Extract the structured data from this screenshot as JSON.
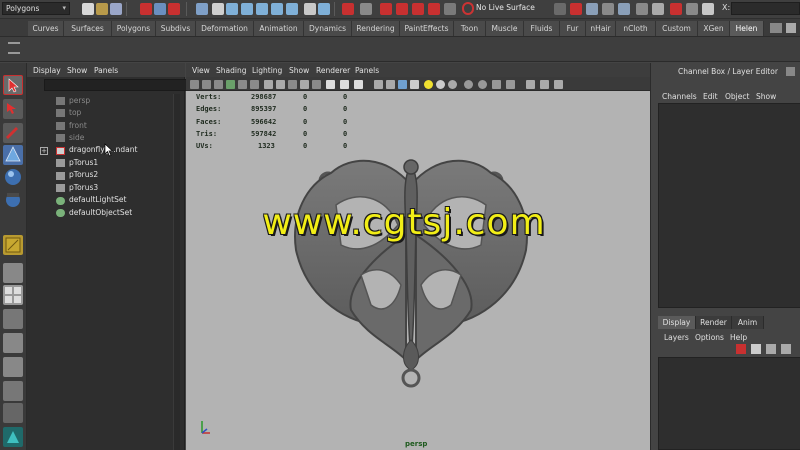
{
  "status_line": {
    "mode": "Polygons",
    "live_surface": "No Live Surface",
    "field_label": "X:"
  },
  "shelf": {
    "tabs": [
      "Curves",
      "Surfaces",
      "Polygons",
      "Subdivs",
      "Deformation",
      "Animation",
      "Dynamics",
      "Rendering",
      "PaintEffects",
      "Toon",
      "Muscle",
      "Fluids",
      "Fur",
      "nHair",
      "nCloth",
      "Custom",
      "XGen",
      "Helen"
    ],
    "active_tab": "Helen"
  },
  "outliner": {
    "menu": [
      "Display",
      "Show",
      "Panels"
    ],
    "items": [
      {
        "label": "persp",
        "dim": true,
        "icon": "camera-icon"
      },
      {
        "label": "top",
        "dim": true,
        "icon": "camera-icon"
      },
      {
        "label": "front",
        "dim": true,
        "icon": "camera-icon"
      },
      {
        "label": "side",
        "dim": true,
        "icon": "camera-icon"
      },
      {
        "label": "dragonfly_pendant",
        "dim": false,
        "icon": "mesh-icon",
        "expandable": true,
        "display_label": "dragonfly_...ndant"
      },
      {
        "label": "pTorus1",
        "dim": false,
        "icon": "transform-icon"
      },
      {
        "label": "pTorus2",
        "dim": false,
        "icon": "transform-icon"
      },
      {
        "label": "pTorus3",
        "dim": false,
        "icon": "transform-icon"
      },
      {
        "label": "defaultLightSet",
        "dim": false,
        "icon": "set-icon"
      },
      {
        "label": "defaultObjectSet",
        "dim": false,
        "icon": "set-icon"
      }
    ]
  },
  "viewport": {
    "menu": [
      "View",
      "Shading",
      "Lighting",
      "Show",
      "Renderer",
      "Panels"
    ],
    "hud": [
      {
        "label": "Verts:",
        "value": "298687",
        "c2": "0",
        "c3": "0"
      },
      {
        "label": "Edges:",
        "value": "895397",
        "c2": "0",
        "c3": "0"
      },
      {
        "label": "Faces:",
        "value": "596642",
        "c2": "0",
        "c3": "0"
      },
      {
        "label": "Tris:",
        "value": "597842",
        "c2": "0",
        "c3": "0"
      },
      {
        "label": "UVs:",
        "value": "1323",
        "c2": "0",
        "c3": "0"
      }
    ],
    "camera": "persp",
    "watermark": "www.cgtsj.com"
  },
  "channel_box": {
    "title": "Channel Box / Layer Editor",
    "menu": [
      "Channels",
      "Edit",
      "Object",
      "Show"
    ],
    "layer_tabs": [
      "Display",
      "Render",
      "Anim"
    ],
    "active_layer_tab": "Display",
    "layer_menu": [
      "Layers",
      "Options",
      "Help"
    ]
  },
  "colors": {
    "accent_red": "#c83030",
    "ui_bg": "#444444",
    "viewport_bg": "#b3b3b3",
    "watermark": "#f2ee16"
  }
}
